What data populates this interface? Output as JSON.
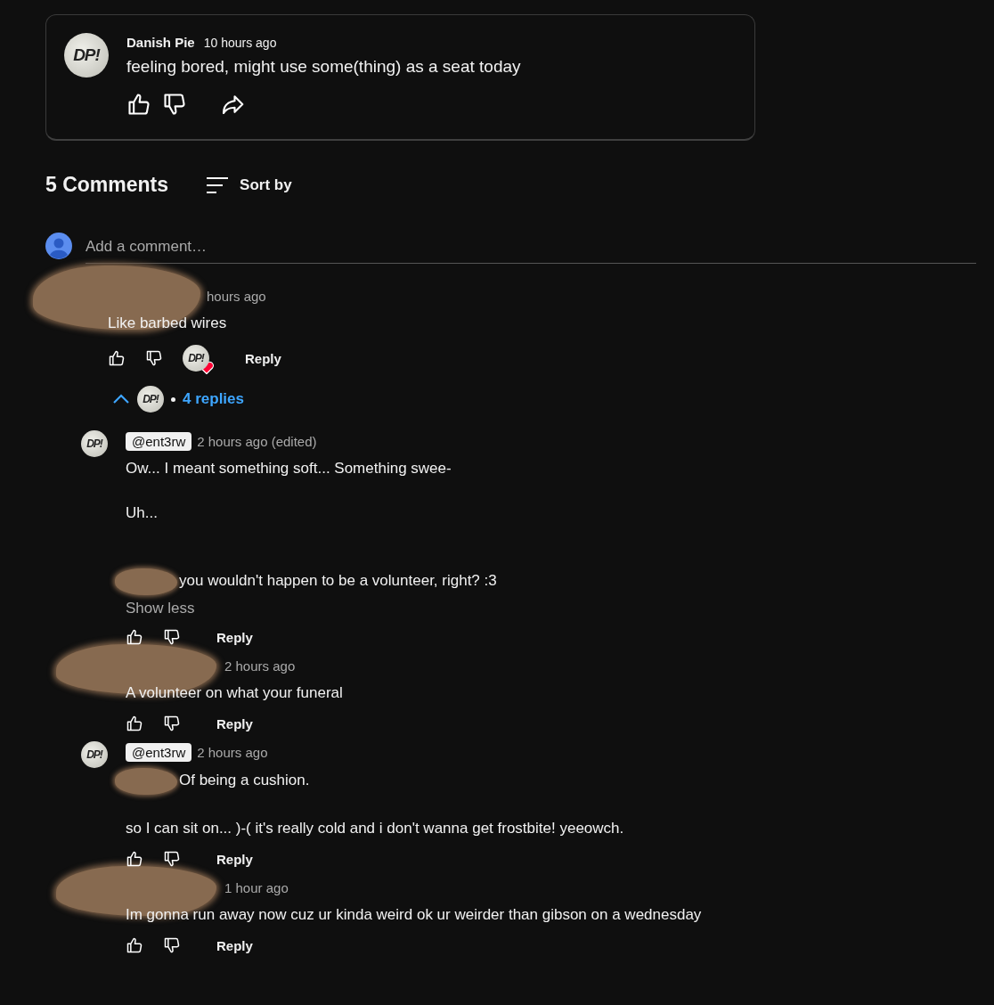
{
  "post": {
    "avatar": "DP!",
    "author": "Danish Pie",
    "time": "10 hours ago",
    "text": "feeling bored, might use some(thing) as a seat today"
  },
  "comments_header": {
    "count": "5 Comments",
    "sort": "Sort by"
  },
  "add_comment": {
    "placeholder": "Add a comment…"
  },
  "comments": [
    {
      "author_redacted": true,
      "time": "hours ago",
      "lines": [
        {
          "kind": "text",
          "text": "Like barbed wires"
        }
      ],
      "hearted_by": "DP!",
      "reply_label": "Reply",
      "replies_toggle": {
        "expanded": true,
        "avatar": "DP!",
        "count": "4 replies"
      },
      "replies": [
        {
          "author_redacted": false,
          "avatar": "DP!",
          "handle": "@ent3rw",
          "time": "2 hours ago (edited)",
          "lines": [
            {
              "kind": "text",
              "text": "Ow... I meant something soft... Something swee-"
            },
            {
              "kind": "break"
            },
            {
              "kind": "text",
              "text": "Uh..."
            },
            {
              "kind": "break"
            },
            {
              "kind": "break"
            },
            {
              "kind": "text",
              "redacted_prefix": true,
              "text": "you wouldn't happen to be a volunteer, right? :3"
            }
          ],
          "show_less": "Show less",
          "reply_label": "Reply"
        },
        {
          "author_redacted": true,
          "time": "2 hours ago",
          "lines": [
            {
              "kind": "text",
              "text": "A volunteer on what your funeral"
            }
          ],
          "reply_label": "Reply"
        },
        {
          "author_redacted": false,
          "avatar": "DP!",
          "handle": "@ent3rw",
          "time": "2 hours ago",
          "lines": [
            {
              "kind": "text",
              "redacted_prefix": true,
              "text": "Of being a cushion."
            },
            {
              "kind": "break"
            },
            {
              "kind": "text",
              "text": "so I can sit on... )-( it's really cold and i don't wanna get frostbite! yeeowch."
            }
          ],
          "reply_label": "Reply"
        },
        {
          "author_redacted": true,
          "time": "1 hour ago",
          "lines": [
            {
              "kind": "text",
              "text": "Im gonna run away now cuz ur kinda weird ok ur weirder than gibson on a wednesday"
            }
          ],
          "reply_label": "Reply"
        }
      ]
    }
  ]
}
